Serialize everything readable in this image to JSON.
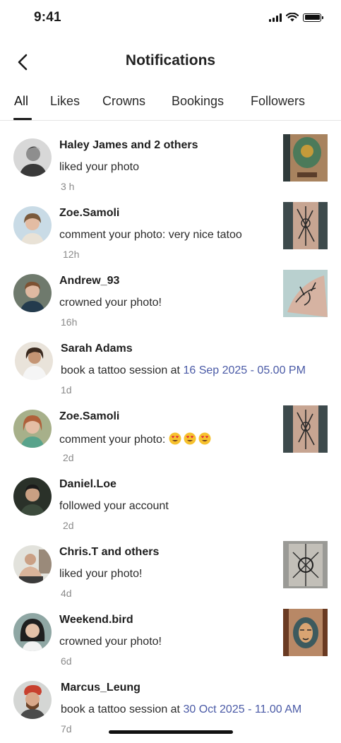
{
  "status": {
    "time": "9:41"
  },
  "header": {
    "title": "Notifications"
  },
  "tabs": [
    {
      "label": "All",
      "active": true
    },
    {
      "label": "Likes"
    },
    {
      "label": "Crowns"
    },
    {
      "label": "Bookings"
    },
    {
      "label": "Followers"
    }
  ],
  "accent_color": "#4a5aa6",
  "notifications": [
    {
      "name": "Haley James and 2 others",
      "text": "liked your photo",
      "time": "3 h"
    },
    {
      "name": "Zoe.Samoli",
      "text": "comment your photo: very nice tatoo",
      "time": "12h"
    },
    {
      "name": "Andrew_93",
      "text": "crowned your photo!",
      "time": "16h"
    },
    {
      "name": "Sarah Adams",
      "text": "book a tattoo session at ",
      "highlight": "16 Sep 2025 - 05.00 PM",
      "time": "1d"
    },
    {
      "name": "Zoe.Samoli",
      "text": "comment your photo: ",
      "emoji": [
        "heart-eyes",
        "heart-eyes",
        "heart-eyes"
      ],
      "time": "2d"
    },
    {
      "name": "Daniel.Loe",
      "text": "followed your account",
      "time": "2d"
    },
    {
      "name": "Chris.T and others",
      "text": "liked your photo!",
      "time": "4d"
    },
    {
      "name": "Weekend.bird",
      "text": "crowned your photo!",
      "time": "6d"
    },
    {
      "name": "Marcus_Leung",
      "text": "book a tattoo session at ",
      "highlight": "30 Oct 2025 - 11.00 AM",
      "time": "7d"
    }
  ]
}
